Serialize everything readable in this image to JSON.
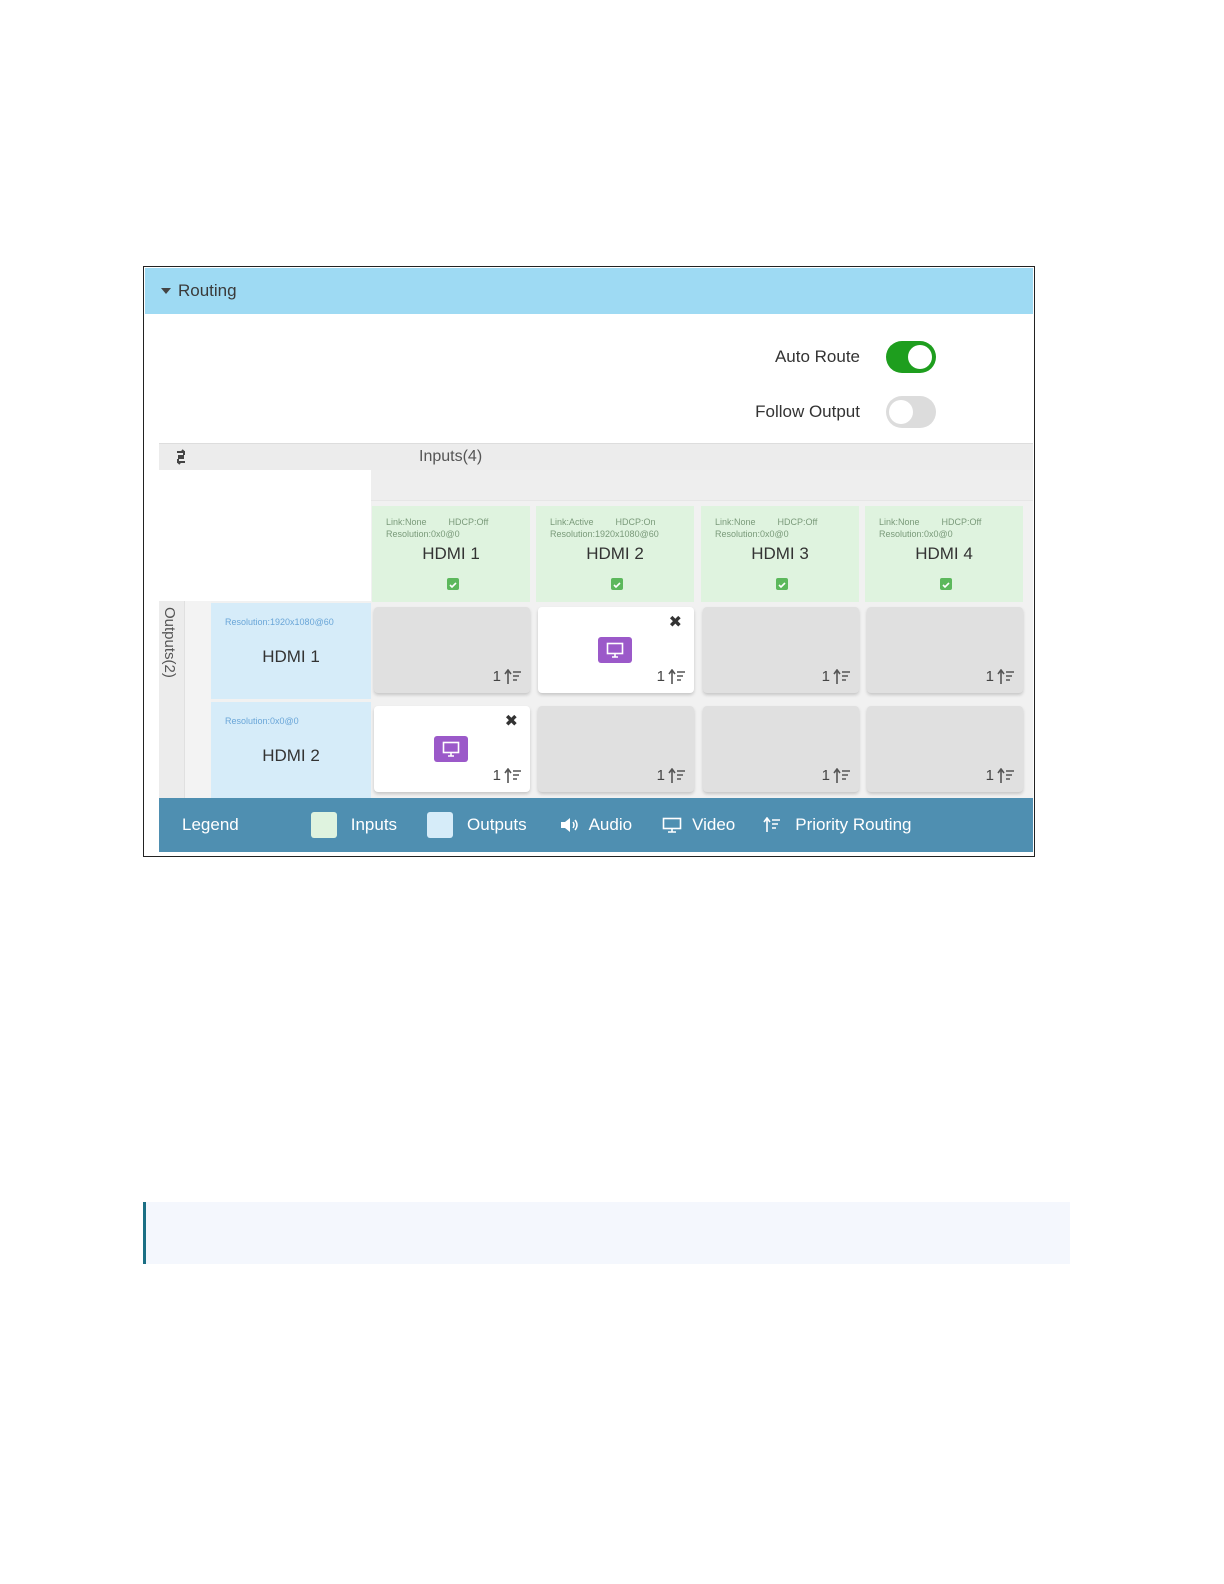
{
  "routing": {
    "title": "Routing",
    "auto_route": {
      "label": "Auto Route",
      "state": "on"
    },
    "follow_output": {
      "label": "Follow Output",
      "state": "off"
    },
    "inputs_title": "Inputs(4)",
    "outputs_title": "Outputs(2)",
    "inputs": [
      {
        "link": "Link:None",
        "hdcp": "HDCP:Off",
        "resolution": "Resolution:0x0@0",
        "name": "HDMI 1"
      },
      {
        "link": "Link:Active",
        "hdcp": "HDCP:On",
        "resolution": "Resolution:1920x1080@60",
        "name": "HDMI 2"
      },
      {
        "link": "Link:None",
        "hdcp": "HDCP:Off",
        "resolution": "Resolution:0x0@0",
        "name": "HDMI 3"
      },
      {
        "link": "Link:None",
        "hdcp": "HDCP:Off",
        "resolution": "Resolution:0x0@0",
        "name": "HDMI 4"
      }
    ],
    "outputs": [
      {
        "resolution": "Resolution:1920x1080@60",
        "name": "HDMI 1"
      },
      {
        "resolution": "Resolution:0x0@0",
        "name": "HDMI 2"
      }
    ],
    "cells": [
      [
        "1",
        "1",
        "1",
        "1"
      ],
      [
        "1",
        "1",
        "1",
        "1"
      ]
    ],
    "close_glyph": "✖",
    "legend": {
      "title": "Legend",
      "inputs": "Inputs",
      "outputs": "Outputs",
      "audio": "Audio",
      "video": "Video",
      "priority": "Priority Routing"
    }
  },
  "colors": {
    "header": "#9edaf3",
    "toggle_on": "#1e9e1e",
    "input_bg": "#dff3df",
    "output_bg": "#d6ecf9",
    "video_badge": "#9b59c9",
    "legend_bg": "#4f8fb1"
  }
}
